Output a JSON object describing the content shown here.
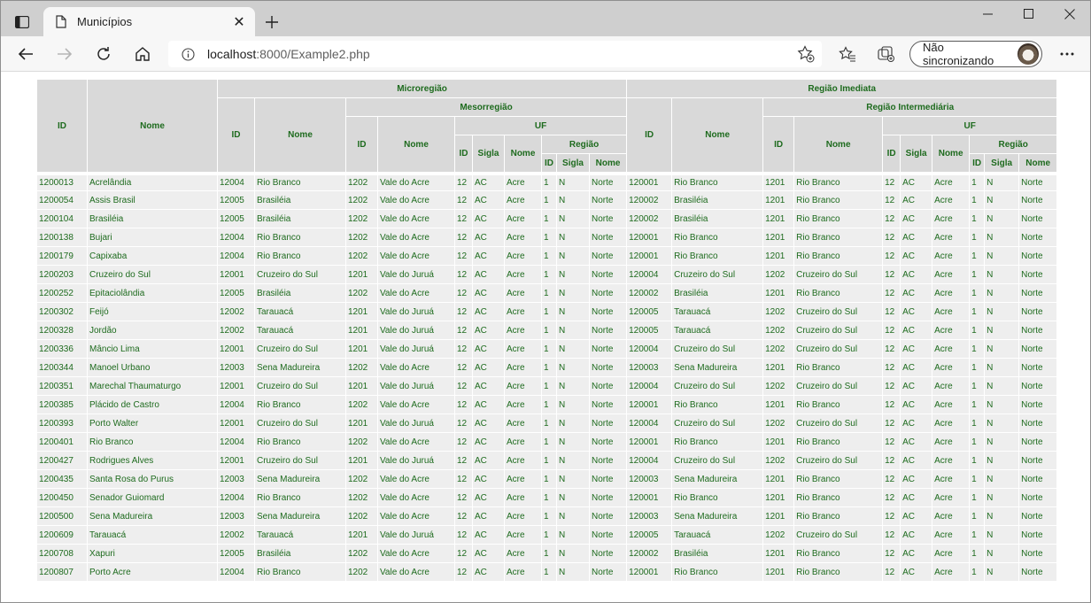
{
  "browser": {
    "tab_title": "Municípios",
    "tab_close": "✕",
    "url_host": "localhost",
    "url_rest": ":8000/Example2.php",
    "sync_label": "Não sincronizando"
  },
  "table": {
    "headers": {
      "id": "ID",
      "nome": "Nome",
      "microregiao": "Microregião",
      "mesorregiao": "Mesorregião",
      "uf": "UF",
      "regiao": "Região",
      "sigla": "Sigla",
      "regiao_imediata": "Região Imediata",
      "regiao_intermediaria": "Região Intermediária"
    },
    "rows": [
      [
        "1200013",
        "Acrelândia",
        "12004",
        "Rio Branco",
        "1202",
        "Vale do Acre",
        "12",
        "AC",
        "Acre",
        "1",
        "N",
        "Norte",
        "120001",
        "Rio Branco",
        "1201",
        "Rio Branco",
        "12",
        "AC",
        "Acre",
        "1",
        "N",
        "Norte"
      ],
      [
        "1200054",
        "Assis Brasil",
        "12005",
        "Brasiléia",
        "1202",
        "Vale do Acre",
        "12",
        "AC",
        "Acre",
        "1",
        "N",
        "Norte",
        "120002",
        "Brasiléia",
        "1201",
        "Rio Branco",
        "12",
        "AC",
        "Acre",
        "1",
        "N",
        "Norte"
      ],
      [
        "1200104",
        "Brasiléia",
        "12005",
        "Brasiléia",
        "1202",
        "Vale do Acre",
        "12",
        "AC",
        "Acre",
        "1",
        "N",
        "Norte",
        "120002",
        "Brasiléia",
        "1201",
        "Rio Branco",
        "12",
        "AC",
        "Acre",
        "1",
        "N",
        "Norte"
      ],
      [
        "1200138",
        "Bujari",
        "12004",
        "Rio Branco",
        "1202",
        "Vale do Acre",
        "12",
        "AC",
        "Acre",
        "1",
        "N",
        "Norte",
        "120001",
        "Rio Branco",
        "1201",
        "Rio Branco",
        "12",
        "AC",
        "Acre",
        "1",
        "N",
        "Norte"
      ],
      [
        "1200179",
        "Capixaba",
        "12004",
        "Rio Branco",
        "1202",
        "Vale do Acre",
        "12",
        "AC",
        "Acre",
        "1",
        "N",
        "Norte",
        "120001",
        "Rio Branco",
        "1201",
        "Rio Branco",
        "12",
        "AC",
        "Acre",
        "1",
        "N",
        "Norte"
      ],
      [
        "1200203",
        "Cruzeiro do Sul",
        "12001",
        "Cruzeiro do Sul",
        "1201",
        "Vale do Juruá",
        "12",
        "AC",
        "Acre",
        "1",
        "N",
        "Norte",
        "120004",
        "Cruzeiro do Sul",
        "1202",
        "Cruzeiro do Sul",
        "12",
        "AC",
        "Acre",
        "1",
        "N",
        "Norte"
      ],
      [
        "1200252",
        "Epitaciolândia",
        "12005",
        "Brasiléia",
        "1202",
        "Vale do Acre",
        "12",
        "AC",
        "Acre",
        "1",
        "N",
        "Norte",
        "120002",
        "Brasiléia",
        "1201",
        "Rio Branco",
        "12",
        "AC",
        "Acre",
        "1",
        "N",
        "Norte"
      ],
      [
        "1200302",
        "Feijó",
        "12002",
        "Tarauacá",
        "1201",
        "Vale do Juruá",
        "12",
        "AC",
        "Acre",
        "1",
        "N",
        "Norte",
        "120005",
        "Tarauacá",
        "1202",
        "Cruzeiro do Sul",
        "12",
        "AC",
        "Acre",
        "1",
        "N",
        "Norte"
      ],
      [
        "1200328",
        "Jordão",
        "12002",
        "Tarauacá",
        "1201",
        "Vale do Juruá",
        "12",
        "AC",
        "Acre",
        "1",
        "N",
        "Norte",
        "120005",
        "Tarauacá",
        "1202",
        "Cruzeiro do Sul",
        "12",
        "AC",
        "Acre",
        "1",
        "N",
        "Norte"
      ],
      [
        "1200336",
        "Mâncio Lima",
        "12001",
        "Cruzeiro do Sul",
        "1201",
        "Vale do Juruá",
        "12",
        "AC",
        "Acre",
        "1",
        "N",
        "Norte",
        "120004",
        "Cruzeiro do Sul",
        "1202",
        "Cruzeiro do Sul",
        "12",
        "AC",
        "Acre",
        "1",
        "N",
        "Norte"
      ],
      [
        "1200344",
        "Manoel Urbano",
        "12003",
        "Sena Madureira",
        "1202",
        "Vale do Acre",
        "12",
        "AC",
        "Acre",
        "1",
        "N",
        "Norte",
        "120003",
        "Sena Madureira",
        "1201",
        "Rio Branco",
        "12",
        "AC",
        "Acre",
        "1",
        "N",
        "Norte"
      ],
      [
        "1200351",
        "Marechal Thaumaturgo",
        "12001",
        "Cruzeiro do Sul",
        "1201",
        "Vale do Juruá",
        "12",
        "AC",
        "Acre",
        "1",
        "N",
        "Norte",
        "120004",
        "Cruzeiro do Sul",
        "1202",
        "Cruzeiro do Sul",
        "12",
        "AC",
        "Acre",
        "1",
        "N",
        "Norte"
      ],
      [
        "1200385",
        "Plácido de Castro",
        "12004",
        "Rio Branco",
        "1202",
        "Vale do Acre",
        "12",
        "AC",
        "Acre",
        "1",
        "N",
        "Norte",
        "120001",
        "Rio Branco",
        "1201",
        "Rio Branco",
        "12",
        "AC",
        "Acre",
        "1",
        "N",
        "Norte"
      ],
      [
        "1200393",
        "Porto Walter",
        "12001",
        "Cruzeiro do Sul",
        "1201",
        "Vale do Juruá",
        "12",
        "AC",
        "Acre",
        "1",
        "N",
        "Norte",
        "120004",
        "Cruzeiro do Sul",
        "1202",
        "Cruzeiro do Sul",
        "12",
        "AC",
        "Acre",
        "1",
        "N",
        "Norte"
      ],
      [
        "1200401",
        "Rio Branco",
        "12004",
        "Rio Branco",
        "1202",
        "Vale do Acre",
        "12",
        "AC",
        "Acre",
        "1",
        "N",
        "Norte",
        "120001",
        "Rio Branco",
        "1201",
        "Rio Branco",
        "12",
        "AC",
        "Acre",
        "1",
        "N",
        "Norte"
      ],
      [
        "1200427",
        "Rodrigues Alves",
        "12001",
        "Cruzeiro do Sul",
        "1201",
        "Vale do Juruá",
        "12",
        "AC",
        "Acre",
        "1",
        "N",
        "Norte",
        "120004",
        "Cruzeiro do Sul",
        "1202",
        "Cruzeiro do Sul",
        "12",
        "AC",
        "Acre",
        "1",
        "N",
        "Norte"
      ],
      [
        "1200435",
        "Santa Rosa do Purus",
        "12003",
        "Sena Madureira",
        "1202",
        "Vale do Acre",
        "12",
        "AC",
        "Acre",
        "1",
        "N",
        "Norte",
        "120003",
        "Sena Madureira",
        "1201",
        "Rio Branco",
        "12",
        "AC",
        "Acre",
        "1",
        "N",
        "Norte"
      ],
      [
        "1200450",
        "Senador Guiomard",
        "12004",
        "Rio Branco",
        "1202",
        "Vale do Acre",
        "12",
        "AC",
        "Acre",
        "1",
        "N",
        "Norte",
        "120001",
        "Rio Branco",
        "1201",
        "Rio Branco",
        "12",
        "AC",
        "Acre",
        "1",
        "N",
        "Norte"
      ],
      [
        "1200500",
        "Sena Madureira",
        "12003",
        "Sena Madureira",
        "1202",
        "Vale do Acre",
        "12",
        "AC",
        "Acre",
        "1",
        "N",
        "Norte",
        "120003",
        "Sena Madureira",
        "1201",
        "Rio Branco",
        "12",
        "AC",
        "Acre",
        "1",
        "N",
        "Norte"
      ],
      [
        "1200609",
        "Tarauacá",
        "12002",
        "Tarauacá",
        "1201",
        "Vale do Juruá",
        "12",
        "AC",
        "Acre",
        "1",
        "N",
        "Norte",
        "120005",
        "Tarauacá",
        "1202",
        "Cruzeiro do Sul",
        "12",
        "AC",
        "Acre",
        "1",
        "N",
        "Norte"
      ],
      [
        "1200708",
        "Xapuri",
        "12005",
        "Brasiléia",
        "1202",
        "Vale do Acre",
        "12",
        "AC",
        "Acre",
        "1",
        "N",
        "Norte",
        "120002",
        "Brasiléia",
        "1201",
        "Rio Branco",
        "12",
        "AC",
        "Acre",
        "1",
        "N",
        "Norte"
      ],
      [
        "1200807",
        "Porto Acre",
        "12004",
        "Rio Branco",
        "1202",
        "Vale do Acre",
        "12",
        "AC",
        "Acre",
        "1",
        "N",
        "Norte",
        "120001",
        "Rio Branco",
        "1201",
        "Rio Branco",
        "12",
        "AC",
        "Acre",
        "1",
        "N",
        "Norte"
      ]
    ]
  },
  "icons": {
    "tab_actions": "tab-actions-icon",
    "page": "page-icon",
    "new_tab": "plus-icon",
    "minimize": "minimize-icon",
    "maximize": "maximize-icon",
    "close": "close-icon",
    "back": "back-arrow-icon",
    "forward": "forward-arrow-icon",
    "refresh": "refresh-icon",
    "home": "home-icon",
    "info": "info-icon",
    "add_favorite": "add-favorite-icon",
    "favorites": "favorites-icon",
    "collections": "collections-icon",
    "more": "more-icon"
  },
  "colors": {
    "header_bg": "#d9d9d9",
    "cell_bg": "#eeeeee",
    "text_green": "#1e6b1e"
  }
}
